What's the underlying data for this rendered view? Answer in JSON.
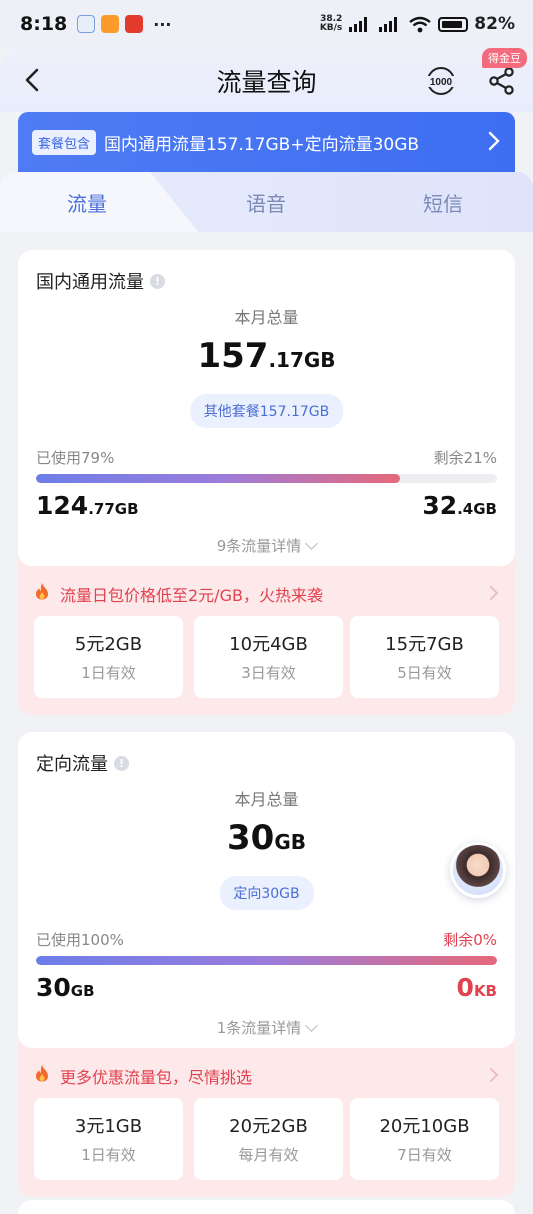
{
  "status_bar": {
    "time": "8:18",
    "more": "···",
    "net_speed_value": "38.2",
    "net_speed_unit": "KB/s",
    "battery": "82%"
  },
  "header": {
    "title": "流量查询",
    "badge": "得金豆"
  },
  "package": {
    "tag": "套餐包含",
    "text": "国内通用流量157.17GB+定向流量30GB"
  },
  "tabs": [
    {
      "label": "流量",
      "active": true
    },
    {
      "label": "语音",
      "active": false
    },
    {
      "label": "短信",
      "active": false
    }
  ],
  "general": {
    "title": "国内通用流量",
    "total_label": "本月总量",
    "total_num": "157",
    "total_dec": ".17GB",
    "pill": "其他套餐157.17GB",
    "used_label": "已使用79%",
    "remain_label": "剩余21%",
    "used_percent": 79,
    "used_num": "124",
    "used_unit": ".77GB",
    "remain_num": "32",
    "remain_unit": ".4GB",
    "detail": "9条流量详情",
    "promo": "流量日包价格低至2元/GB，火热来袭",
    "offers": [
      {
        "name": "5元2GB",
        "valid": "1日有效"
      },
      {
        "name": "10元4GB",
        "valid": "3日有效"
      },
      {
        "name": "15元7GB",
        "valid": "5日有效"
      }
    ]
  },
  "directed": {
    "title": "定向流量",
    "total_label": "本月总量",
    "total_num": "30",
    "total_dec": "GB",
    "pill": "定向30GB",
    "used_label": "已使用100%",
    "remain_label": "剩余0%",
    "used_percent": 100,
    "used_num": "30",
    "used_unit": "GB",
    "remain_num": "0",
    "remain_unit": "KB",
    "detail": "1条流量详情",
    "promo": "更多优惠流量包，尽情挑选",
    "offers": [
      {
        "name": "3元1GB",
        "valid": "1日有效"
      },
      {
        "name": "20元2GB",
        "valid": "每月有效"
      },
      {
        "name": "20元10GB",
        "valid": "7日有效"
      }
    ]
  },
  "colors": {
    "primary_blue": "#3d6ef1",
    "accent_red": "#e2414f",
    "tab_active": "#4a6fdc",
    "promo_bg": "#fde9ea"
  },
  "icons": [
    "back-arrow-icon",
    "hotline-10000-icon",
    "share-icon",
    "chevron-right-icon",
    "info-icon",
    "fire-icon",
    "chevron-down-icon"
  ]
}
